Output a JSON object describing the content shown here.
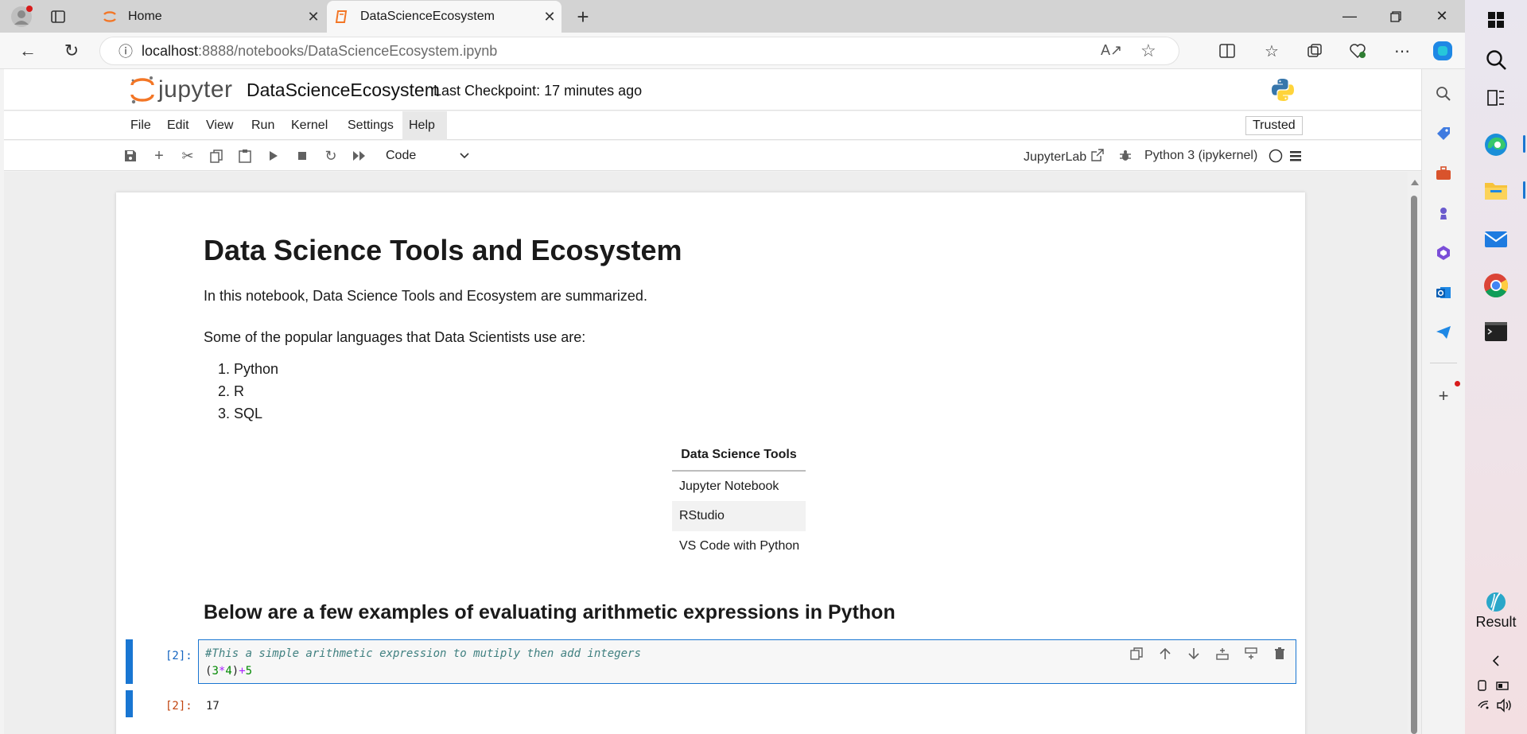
{
  "browser": {
    "tabs": [
      {
        "title": "Home",
        "active": false
      },
      {
        "title": "DataScienceEcosystem",
        "active": true
      }
    ],
    "url": {
      "host": "localhost",
      "path": ":8888/notebooks/DataScienceEcosystem.ipynb"
    }
  },
  "taskbar": {
    "result_label": "Result"
  },
  "jupyter": {
    "logo_text": "jupyter",
    "notebook_title": "DataScienceEcosystem",
    "checkpoint": "Last Checkpoint: 17 minutes ago",
    "menu": [
      "File",
      "Edit",
      "View",
      "Run",
      "Kernel",
      "Settings",
      "Help"
    ],
    "trusted": "Trusted",
    "cell_type": "Code",
    "jupyterlab_link": "JupyterLab",
    "kernel": "Python 3 (ipykernel)"
  },
  "notebook": {
    "heading": "Data Science Tools and Ecosystem",
    "intro": "In this notebook, Data Science Tools and Ecosystem are summarized.",
    "languages_intro": "Some of the popular languages that Data Scientists use are:",
    "languages": [
      "1. Python",
      "2. R",
      "3. SQL"
    ],
    "tools_table": {
      "header": "Data Science Tools",
      "rows": [
        "Jupyter Notebook",
        "RStudio",
        "VS Code with Python"
      ]
    },
    "examples_heading": "Below are a few examples of evaluating arithmetic expressions in Python",
    "code_cell": {
      "in_prompt": "[2]:",
      "comment": "#This a simple arithmetic expression to mutiply then add integers",
      "expr_open": "(",
      "expr_a": "3",
      "expr_mul": "*",
      "expr_b": "4",
      "expr_close": ")",
      "expr_plus": "+",
      "expr_c": "5",
      "out_prompt": "[2]:",
      "output": "17"
    }
  }
}
